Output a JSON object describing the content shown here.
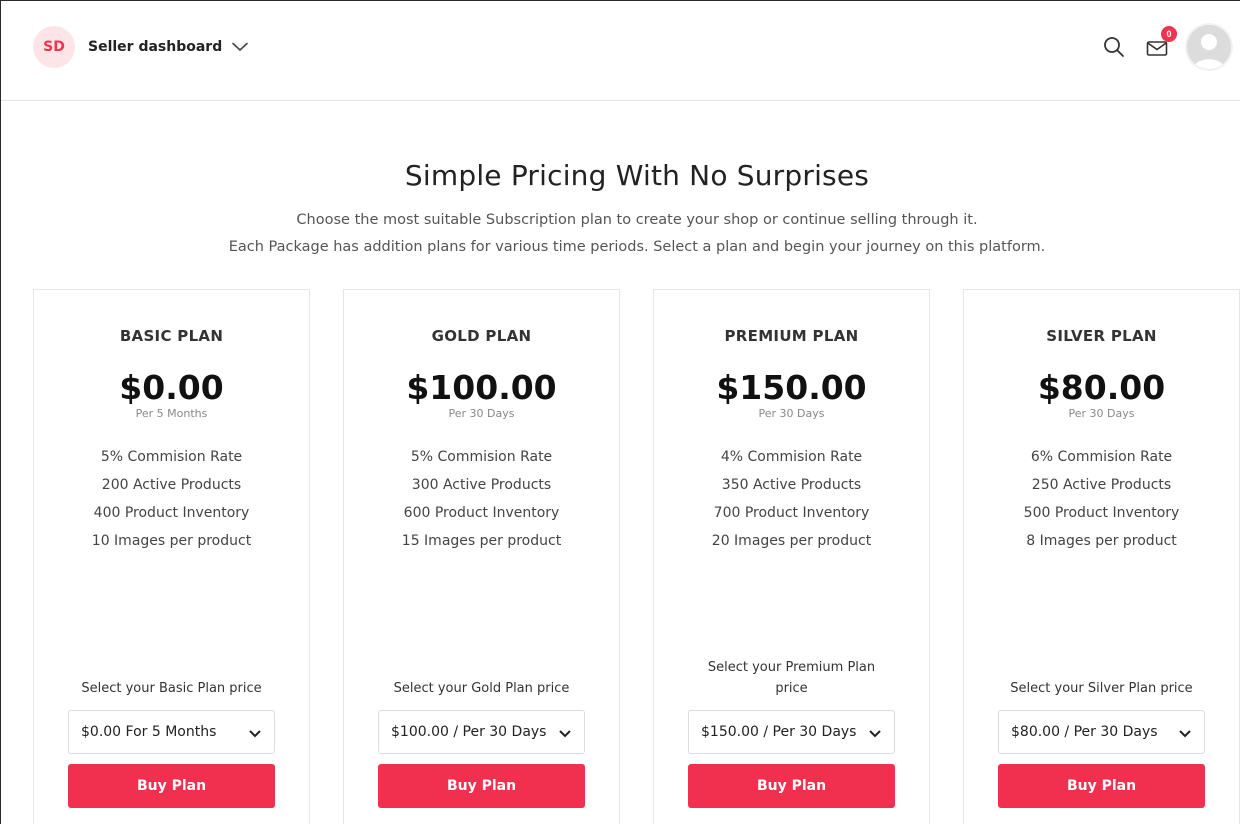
{
  "header": {
    "brand_initials": "SD",
    "brand_name": "Seller dashboard",
    "notification_count": "0"
  },
  "hero": {
    "title": "Simple Pricing With No Surprises",
    "subtitle_line1": "Choose the most suitable Subscription plan to create your shop or continue selling through it.",
    "subtitle_line2": "Each Package has addition plans for various time periods. Select a plan and begin your journey on this platform."
  },
  "plans": [
    {
      "name": "BASIC PLAN",
      "price": "$0.00",
      "period": "Per 5 Months",
      "commission": "5% Commision Rate",
      "active_products": "200 Active Products",
      "inventory": "400 Product Inventory",
      "images": "10 Images per product",
      "select_label": "Select your Basic Plan price",
      "selected_option": "$0.00 For 5 Months",
      "button_label": "Buy Plan"
    },
    {
      "name": "GOLD PLAN",
      "price": "$100.00",
      "period": "Per 30 Days",
      "commission": "5% Commision Rate",
      "active_products": "300 Active Products",
      "inventory": "600 Product Inventory",
      "images": "15 Images per product",
      "select_label": "Select your Gold Plan price",
      "selected_option": "$100.00 / Per 30 Days",
      "button_label": "Buy Plan"
    },
    {
      "name": "PREMIUM PLAN",
      "price": "$150.00",
      "period": "Per 30 Days",
      "commission": "4% Commision Rate",
      "active_products": "350 Active Products",
      "inventory": "700 Product Inventory",
      "images": "20 Images per product",
      "select_label": "Select your Premium Plan price",
      "selected_option": "$150.00 / Per 30 Days",
      "button_label": "Buy Plan"
    },
    {
      "name": "SILVER PLAN",
      "price": "$80.00",
      "period": "Per 30 Days",
      "commission": "6% Commision Rate",
      "active_products": "250 Active Products",
      "inventory": "500 Product Inventory",
      "images": "8 Images per product",
      "select_label": "Select your Silver Plan price",
      "selected_option": "$80.00 / Per 30 Days",
      "button_label": "Buy Plan"
    }
  ],
  "colors": {
    "accent": "#f1304f",
    "brand_avatar_bg": "#fde5e7"
  },
  "icons": {
    "brand_chevron": "chevron-down-icon",
    "search": "search-icon",
    "mail": "mail-icon",
    "user": "user-avatar-icon"
  }
}
